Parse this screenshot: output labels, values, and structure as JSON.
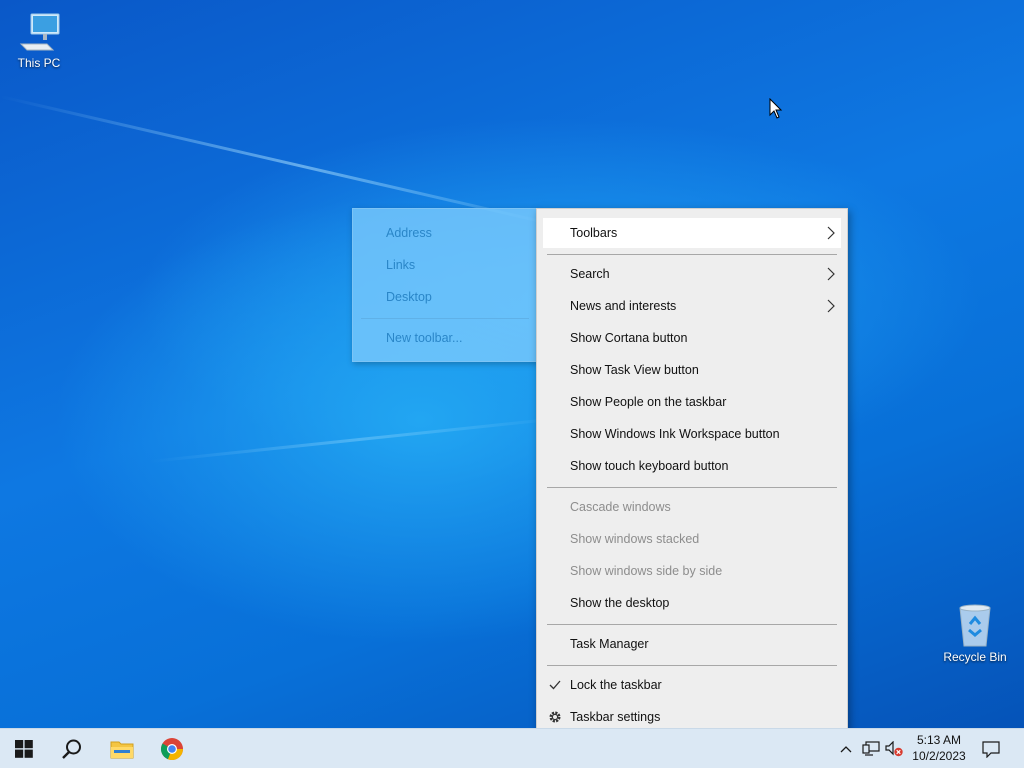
{
  "desktop": {
    "icons": [
      {
        "label": "This PC",
        "icon": "this-pc-icon"
      },
      {
        "label": "Recycle Bin",
        "icon": "recycle-bin-icon"
      }
    ]
  },
  "context_menu": {
    "items": [
      {
        "label": "Toolbars",
        "state": "highlighted",
        "submenu": true
      },
      {
        "label": "Search",
        "submenu": true
      },
      {
        "label": "News and interests",
        "submenu": true
      },
      {
        "label": "Show Cortana button"
      },
      {
        "label": "Show Task View button"
      },
      {
        "label": "Show People on the taskbar"
      },
      {
        "label": "Show Windows Ink Workspace button"
      },
      {
        "label": "Show touch keyboard button"
      },
      {
        "label": "Cascade windows",
        "state": "disabled"
      },
      {
        "label": "Show windows stacked",
        "state": "disabled"
      },
      {
        "label": "Show windows side by side",
        "state": "disabled"
      },
      {
        "label": "Show the desktop"
      },
      {
        "label": "Task Manager"
      },
      {
        "label": "Lock the taskbar",
        "checked": true
      },
      {
        "label": "Taskbar settings",
        "icon": "gear-icon"
      }
    ]
  },
  "toolbars_submenu": {
    "items": [
      {
        "label": "Address"
      },
      {
        "label": "Links"
      },
      {
        "label": "Desktop"
      },
      {
        "label": "New toolbar..."
      }
    ]
  },
  "taskbar": {
    "pinned": [
      "start-icon",
      "search-icon",
      "file-explorer-icon",
      "chrome-icon"
    ],
    "tray": [
      "chevron-up-icon",
      "network-icon",
      "volume-muted-icon"
    ],
    "clock": {
      "time": "5:13 AM",
      "date": "10/2/2023"
    },
    "notifications_icon": "action-center-icon"
  },
  "colors": {
    "desktop_blue": "#0e78e2",
    "taskbar": "#dbe8f4",
    "menu_bg": "#eeeeee",
    "submenu_bg": "#78c8fc",
    "disabled_text": "#8d8d8d"
  }
}
